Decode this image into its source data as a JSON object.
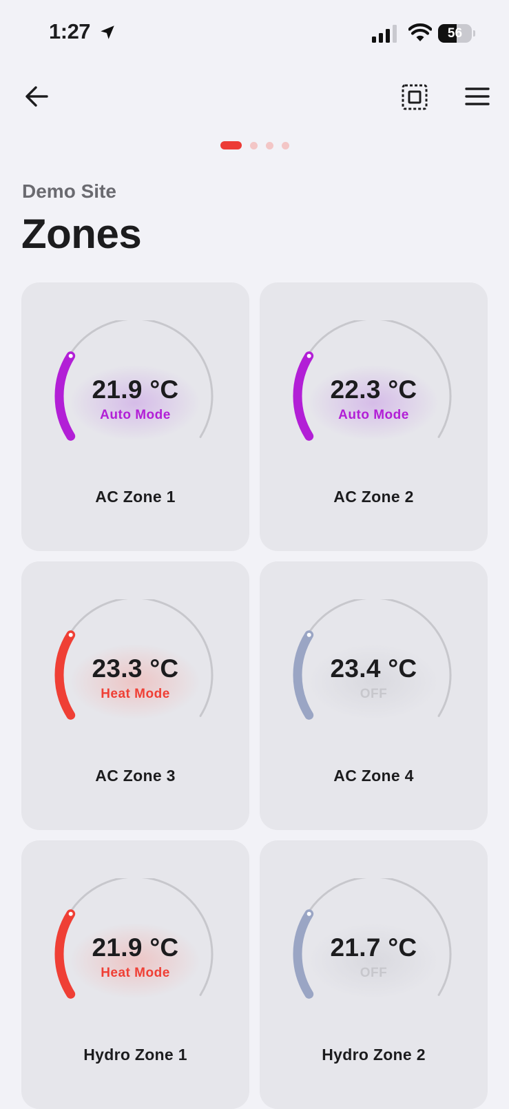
{
  "status_bar": {
    "time": "1:27",
    "battery": "56",
    "battery_level": 0.56
  },
  "nav": {
    "back_icon": "arrow-left-icon",
    "scan_icon": "scan-icon",
    "menu_icon": "hamburger-menu-icon"
  },
  "pager": {
    "pages": 4,
    "active": 0
  },
  "header": {
    "site_name": "Demo Site",
    "title": "Zones"
  },
  "colors": {
    "auto": "#b21fd6",
    "heat": "#ef3f35",
    "off_arc": "#9aa5c4",
    "off_text": "#c7c7cc",
    "pager_active": "#ec3b36",
    "pager_inactive": "#f3c6c6"
  },
  "zones": [
    {
      "name": "AC Zone 1",
      "temp": "21.9 °C",
      "mode": "Auto Mode",
      "mode_color": "#b21fd6",
      "glow": "#c89ae6"
    },
    {
      "name": "AC Zone 2",
      "temp": "22.3 °C",
      "mode": "Auto Mode",
      "mode_color": "#b21fd6",
      "glow": "#c89ae6"
    },
    {
      "name": "AC Zone 3",
      "temp": "23.3 °C",
      "mode": "Heat Mode",
      "mode_color": "#ef3f35",
      "glow": "#f2aaa6"
    },
    {
      "name": "AC Zone 4",
      "temp": "23.4 °C",
      "mode": "OFF",
      "mode_color": "#c7c7cc",
      "glow": "#cfcfd6"
    },
    {
      "name": "Hydro Zone 1",
      "temp": "21.9 °C",
      "mode": "Heat Mode",
      "mode_color": "#ef3f35",
      "glow": "#f2aaa6"
    },
    {
      "name": "Hydro Zone 2",
      "temp": "21.7 °C",
      "mode": "OFF",
      "mode_color": "#c7c7cc",
      "glow": "#cfcfd6"
    }
  ],
  "arc_colors": [
    "#b21fd6",
    "#b21fd6",
    "#ef3f35",
    "#9aa5c4",
    "#ef3f35",
    "#9aa5c4"
  ]
}
